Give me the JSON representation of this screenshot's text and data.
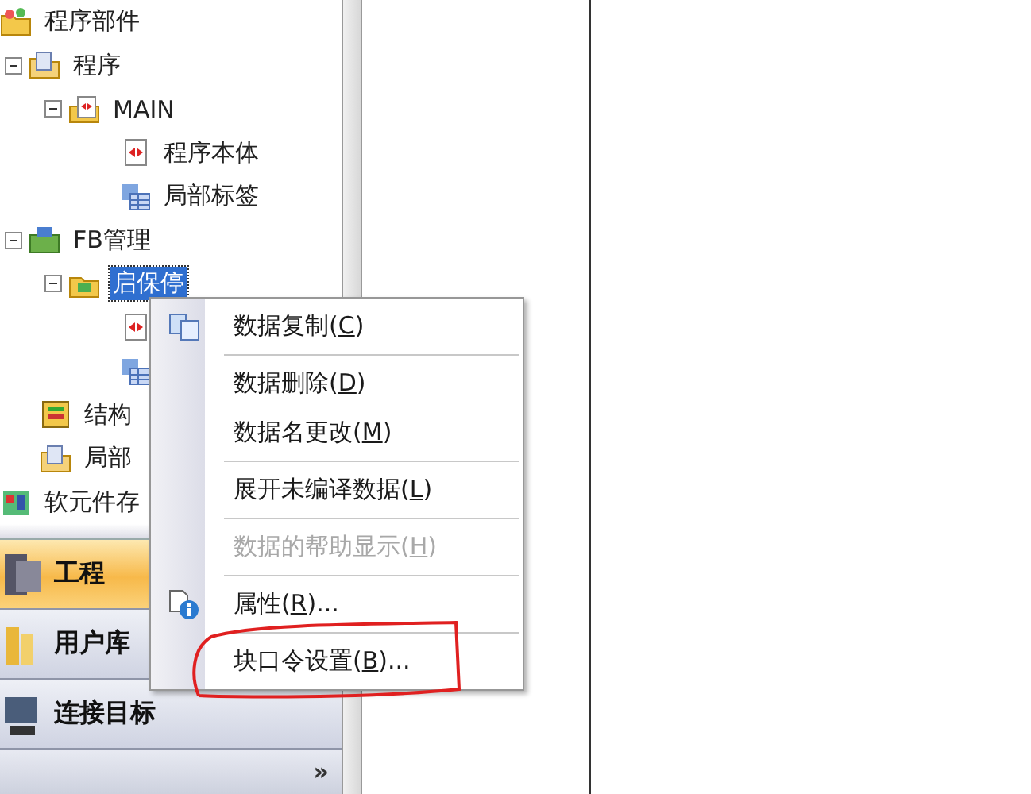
{
  "tree": [
    {
      "label": "程序部件",
      "kind": "parts",
      "selected": false,
      "children": [
        {
          "label": "程序",
          "kind": "folder",
          "expanded": true,
          "selected": false,
          "children": [
            {
              "label": "MAIN",
              "kind": "program",
              "expanded": true,
              "selected": false,
              "children": [
                {
                  "label": "程序本体",
                  "kind": "ladder",
                  "selected": false
                },
                {
                  "label": "局部标签",
                  "kind": "table",
                  "selected": false
                }
              ]
            }
          ]
        },
        {
          "label": "FB管理",
          "kind": "fb",
          "expanded": true,
          "selected": false,
          "children": [
            {
              "label": "启保停",
              "kind": "fbfolder",
              "expanded": true,
              "selected": true,
              "children": [
                {
                  "kind": "ladder"
                },
                {
                  "kind": "table"
                }
              ]
            }
          ]
        },
        {
          "label": "结构",
          "kind": "struct",
          "selected": false
        },
        {
          "label": "局部",
          "kind": "folder",
          "selected": false
        }
      ]
    },
    {
      "label": "软元件存",
      "kind": "device",
      "selected": false
    }
  ],
  "nav": {
    "buttons": [
      {
        "label": "工程",
        "kind": "project",
        "selected": true
      },
      {
        "label": "用户库",
        "kind": "library",
        "selected": false
      },
      {
        "label": "连接目标",
        "kind": "connect",
        "selected": false
      }
    ],
    "more": "»"
  },
  "context_menu": {
    "items": [
      {
        "kind": "copy-item",
        "before": "数据复制(",
        "key": "C",
        "after": ")",
        "disabled": false
      },
      {
        "kind": "separator"
      },
      {
        "kind": "item",
        "before": "数据删除(",
        "key": "D",
        "after": ")",
        "disabled": false
      },
      {
        "kind": "item",
        "before": "数据名更改(",
        "key": "M",
        "after": ")",
        "disabled": false
      },
      {
        "kind": "separator"
      },
      {
        "kind": "item",
        "before": "展开未编译数据(",
        "key": "L",
        "after": ")",
        "disabled": false
      },
      {
        "kind": "separator"
      },
      {
        "kind": "item",
        "before": "数据的帮助显示(",
        "key": "H",
        "after": ")",
        "disabled": true
      },
      {
        "kind": "separator"
      },
      {
        "kind": "properties-item",
        "before": "属性(",
        "key": "R",
        "after": ")...",
        "disabled": false
      },
      {
        "kind": "separator"
      },
      {
        "kind": "item",
        "before": "块口令设置(",
        "key": "B",
        "after": ")...",
        "disabled": false,
        "circled": true
      }
    ]
  }
}
